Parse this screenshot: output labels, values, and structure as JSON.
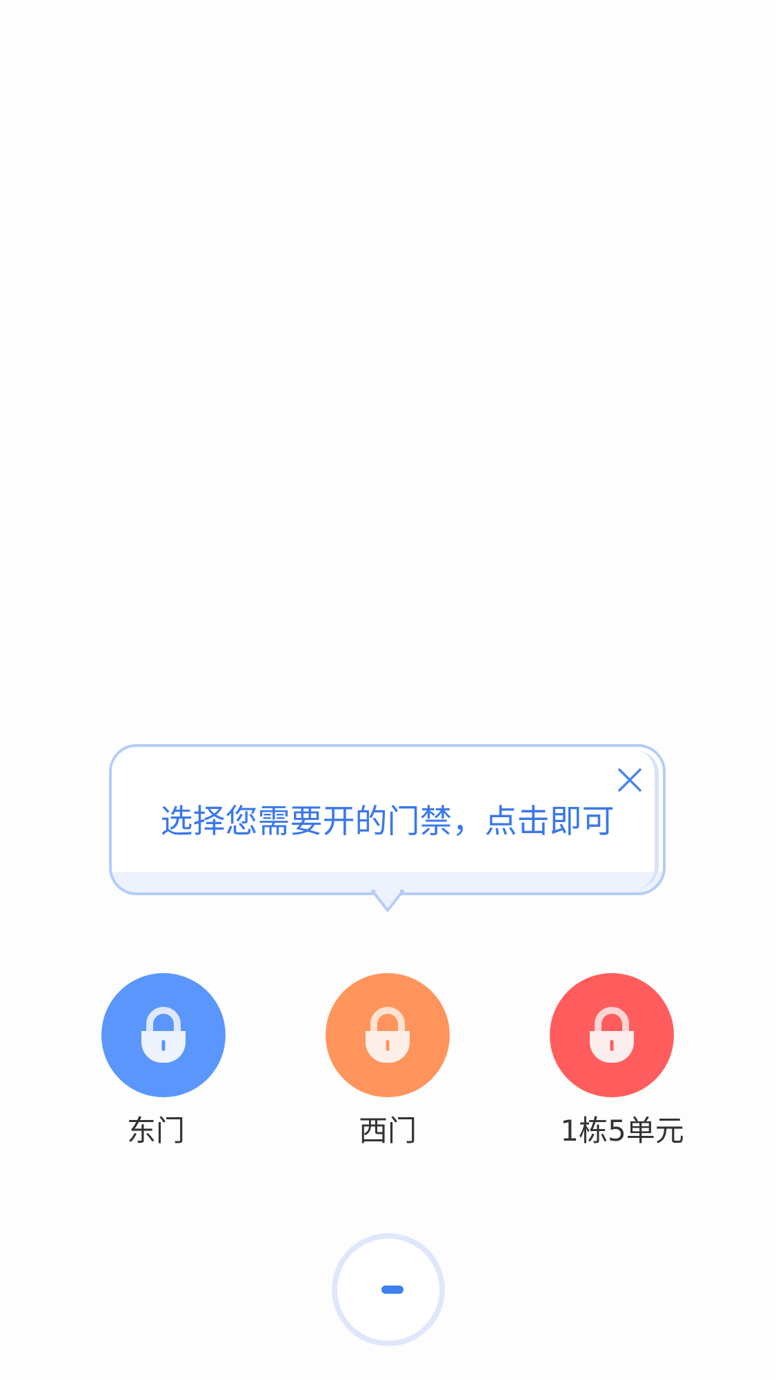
{
  "tooltip": {
    "message": "选择您需要开的门禁，点击即可",
    "close_icon": "close-icon",
    "text_color": "#3a78ea",
    "border_color": "#b4ccf7"
  },
  "doors": [
    {
      "label": "东门",
      "color": "#5b96fc",
      "icon": "lock-icon",
      "keyhole_color": "#5b96fc"
    },
    {
      "label": "西门",
      "color": "#ff955c",
      "icon": "lock-icon",
      "keyhole_color": "#ff955c"
    },
    {
      "label": "1栋5单元",
      "color": "#ff5d5d",
      "icon": "lock-icon",
      "keyhole_color": "#ff5d5d"
    }
  ],
  "bottom_button": {
    "icon": "minus-icon",
    "accent": "#3f7fee"
  }
}
